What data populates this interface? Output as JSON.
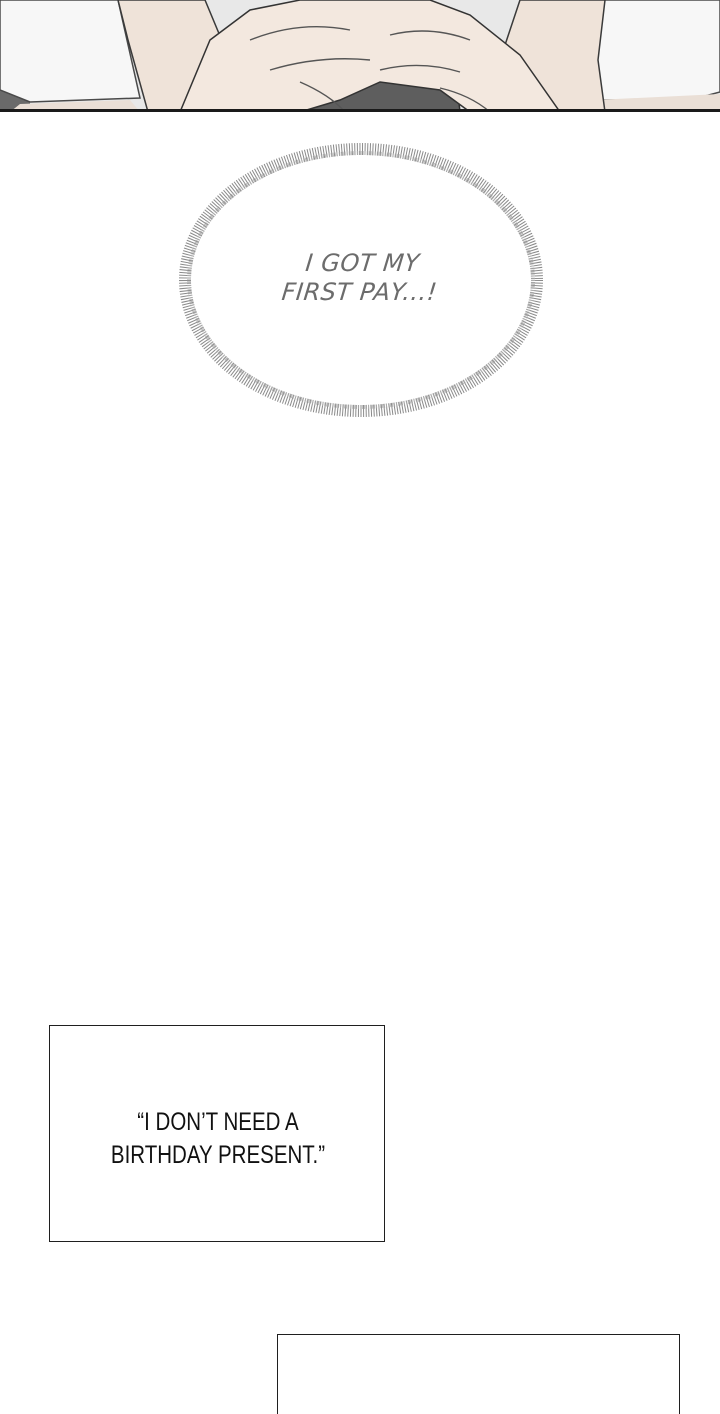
{
  "thought_bubble": {
    "line1": "I GOT MY",
    "line2": "FIRST PAY...!"
  },
  "caption": {
    "line1": "“I DON’T NEED A",
    "line2": "BIRTHDAY PRESENT.”"
  },
  "colors": {
    "background": "#ffffff",
    "panel_border": "#1f1f1f",
    "thought_text": "#6c6c6c",
    "caption_text": "#111111"
  }
}
